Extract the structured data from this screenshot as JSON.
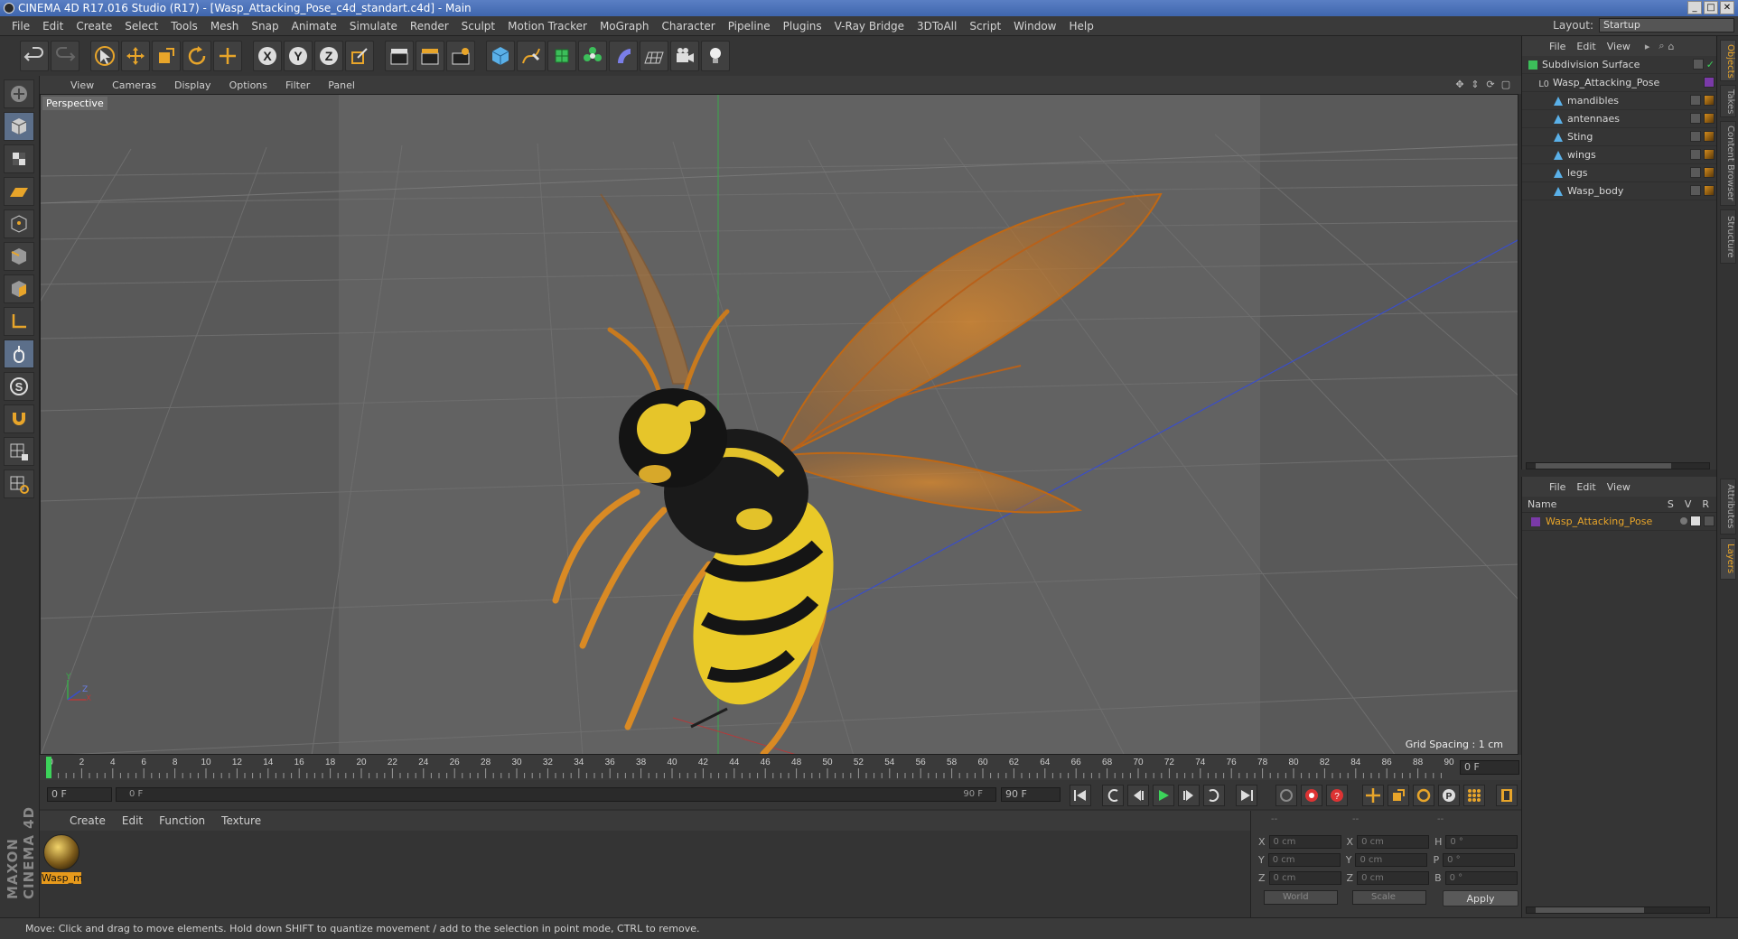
{
  "window": {
    "title": "CINEMA 4D R17.016 Studio (R17) - [Wasp_Attacking_Pose_c4d_standart.c4d] - Main",
    "controls": [
      "_",
      "□",
      "✕"
    ]
  },
  "menu": [
    "File",
    "Edit",
    "Create",
    "Select",
    "Tools",
    "Mesh",
    "Snap",
    "Animate",
    "Simulate",
    "Render",
    "Sculpt",
    "Motion Tracker",
    "MoGraph",
    "Character",
    "Pipeline",
    "Plugins",
    "V-Ray Bridge",
    "3DToAll",
    "Script",
    "Window",
    "Help"
  ],
  "layout": {
    "label": "Layout:",
    "value": "Startup"
  },
  "viewport": {
    "menu": [
      "View",
      "Cameras",
      "Display",
      "Options",
      "Filter",
      "Panel"
    ],
    "camera_label": "Perspective",
    "grid_spacing": "Grid Spacing : 1 cm",
    "nav_icons": [
      "move-view-icon",
      "zoom-view-icon",
      "rotate-view-icon",
      "maximize-view-icon"
    ],
    "axis": {
      "x": "X",
      "y": "Y",
      "z": "Z"
    }
  },
  "timeline": {
    "ticks": [
      "0",
      "2",
      "4",
      "6",
      "8",
      "10",
      "12",
      "14",
      "16",
      "18",
      "20",
      "22",
      "24",
      "26",
      "28",
      "30",
      "32",
      "34",
      "36",
      "38",
      "40",
      "42",
      "44",
      "46",
      "48",
      "50",
      "52",
      "54",
      "56",
      "58",
      "60",
      "62",
      "64",
      "66",
      "68",
      "70",
      "72",
      "74",
      "76",
      "78",
      "80",
      "82",
      "84",
      "86",
      "88",
      "90"
    ],
    "current_frame": "0 F"
  },
  "transport": {
    "start_field": "0 F",
    "slider_start": "0 F",
    "slider_end": "90 F",
    "end_field": "90 F"
  },
  "material_manager": {
    "menu": [
      "Create",
      "Edit",
      "Function",
      "Texture"
    ],
    "materials": [
      {
        "name": "Wasp_m"
      }
    ]
  },
  "coordinates": {
    "header": [
      "--",
      "--",
      "--"
    ],
    "rows": [
      {
        "a": "X",
        "av": "0 cm",
        "b": "X",
        "bv": "0 cm",
        "c": "H",
        "cv": "0 °"
      },
      {
        "a": "Y",
        "av": "0 cm",
        "b": "Y",
        "bv": "0 cm",
        "c": "P",
        "cv": "0 °"
      },
      {
        "a": "Z",
        "av": "0 cm",
        "b": "Z",
        "bv": "0 cm",
        "c": "B",
        "cv": "0 °"
      }
    ],
    "space": "World",
    "mode": "Scale",
    "apply": "Apply"
  },
  "status": "Move: Click and drag to move elements. Hold down SHIFT to quantize movement / add to the selection in point mode, CTRL to remove.",
  "object_manager": {
    "menu": [
      "File",
      "Edit",
      "View"
    ],
    "objects": [
      {
        "name": "Subdivision Surface",
        "depth": 0,
        "color": "#cfcfcf"
      },
      {
        "name": "Wasp_Attacking_Pose",
        "depth": 1,
        "color": "#cfcfcf"
      },
      {
        "name": "mandibles",
        "depth": 2,
        "color": "#cfcfcf"
      },
      {
        "name": "antennaes",
        "depth": 2,
        "color": "#cfcfcf"
      },
      {
        "name": "Sting",
        "depth": 2,
        "color": "#cfcfcf"
      },
      {
        "name": "wings",
        "depth": 2,
        "color": "#cfcfcf"
      },
      {
        "name": "legs",
        "depth": 2,
        "color": "#cfcfcf"
      },
      {
        "name": "Wasp_body",
        "depth": 2,
        "color": "#cfcfcf"
      }
    ]
  },
  "layer_manager": {
    "menu": [
      "File",
      "Edit",
      "View"
    ],
    "header": {
      "name": "Name",
      "s": "S",
      "v": "V",
      "r": "R"
    },
    "layers": [
      {
        "name": "Wasp_Attacking_Pose",
        "color": "#e8a52a"
      }
    ]
  },
  "side_tabs": [
    "Objects",
    "Takes",
    "Content Browser",
    "Structure",
    "Attributes",
    "Layers"
  ],
  "maxon_logo": "MAXON CINEMA 4D",
  "colors": {
    "accent": "#e8a52a",
    "selection_blue": "#5c6f8a",
    "title_blue": "#3f66ad"
  }
}
